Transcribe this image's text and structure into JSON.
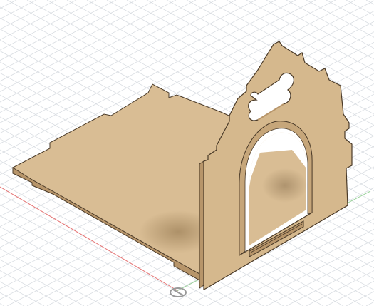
{
  "viewport": {
    "background": "#ffffff",
    "grid_color": "#d9dde2",
    "x_axis_color": "#e57373",
    "y_axis_color": "#9bd39b"
  },
  "model": {
    "name": "dog house",
    "material_top": "#d9bd94",
    "material_edge": "#c2a171",
    "material_shade": "#a98a5c",
    "outline": "#4a3a28",
    "cutout_color": "#ffffff",
    "cutout_icon": "bone-icon"
  }
}
